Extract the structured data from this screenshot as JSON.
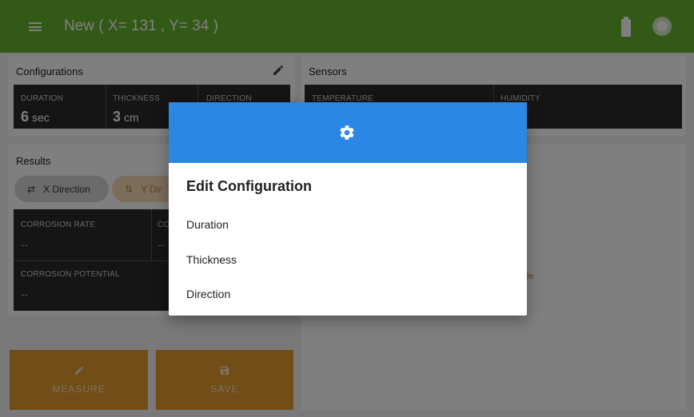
{
  "appbar": {
    "title": "New ( X= 131 , Y= 34 )"
  },
  "configurations": {
    "title": "Configurations",
    "cells": [
      {
        "label": "DURATION",
        "value": "6",
        "unit": "sec"
      },
      {
        "label": "THICKNESS",
        "value": "3",
        "unit": "cm"
      },
      {
        "label": "DIRECTION"
      }
    ]
  },
  "sensors": {
    "title": "Sensors",
    "cells": [
      {
        "label": "TEMPERATURE"
      },
      {
        "label": "HUMIDITY"
      }
    ]
  },
  "results": {
    "title": "Results",
    "tabs": [
      {
        "label": "X Direction"
      },
      {
        "label": "Y Dir"
      }
    ],
    "cells": [
      {
        "label": "CORROSION RATE",
        "value": "--"
      },
      {
        "label": "CO",
        "value": "--"
      },
      {
        "label": "CORROSION POTENTIAL",
        "value": "--"
      }
    ]
  },
  "right_panel": {
    "partial_text": "le"
  },
  "buttons": {
    "measure": "MEASURE",
    "save": "SAVE"
  },
  "dialog": {
    "title": "Edit Configuration",
    "options": [
      "Duration",
      "Thickness",
      "Direction"
    ]
  },
  "colors": {
    "appbar": "#67b32e",
    "dialog_header": "#2a87e4",
    "action_button": "#e39a2f"
  }
}
